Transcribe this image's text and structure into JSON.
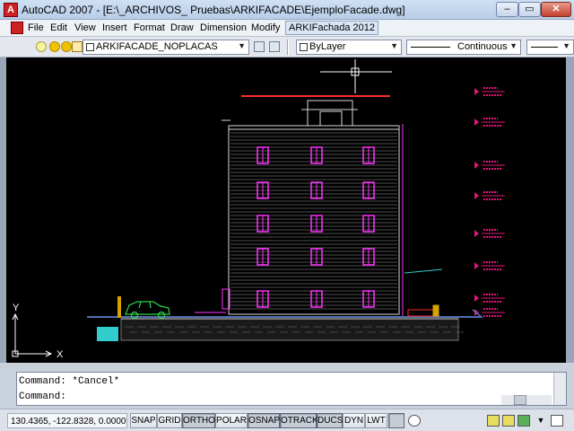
{
  "window": {
    "title": "AutoCAD 2007 - [E:\\_ARCHIVOS_ Pruebas\\ARKIFACADE\\EjemploFacade.dwg]",
    "app_icon": "autocad-logo-icon",
    "minimize": "–",
    "maximize": "▭",
    "close": "✕"
  },
  "menu": {
    "items": [
      "File",
      "Edit",
      "View",
      "Insert",
      "Format",
      "Draw",
      "Dimension",
      "Modify",
      "ARKIFachada 2012"
    ]
  },
  "toolbar": {
    "layer": "ARKIFACADE_NOPLACAS",
    "color": "ByLayer",
    "linetype": "Continuous",
    "lineweight_arrow": "▼"
  },
  "ucs": {
    "y_label": "Y",
    "x_label": "X"
  },
  "command": {
    "line1": "Command: *Cancel*",
    "line2": "Command:"
  },
  "status": {
    "coords": "130.4365, -122.8328, 0.0000",
    "buttons": [
      "SNAP",
      "GRID",
      "ORTHO",
      "POLAR",
      "OSNAP",
      "OTRACK",
      "DUCS",
      "DYN",
      "LWT"
    ]
  },
  "colors": {
    "canvas_bg": "#000000",
    "facade_lines": "#d8d8d8",
    "windows": "#ff33ff",
    "level_markers": "#e0177a",
    "ground": "#4f6fb0",
    "car": "#2ed44a",
    "red_line": "#ff2a2a"
  }
}
